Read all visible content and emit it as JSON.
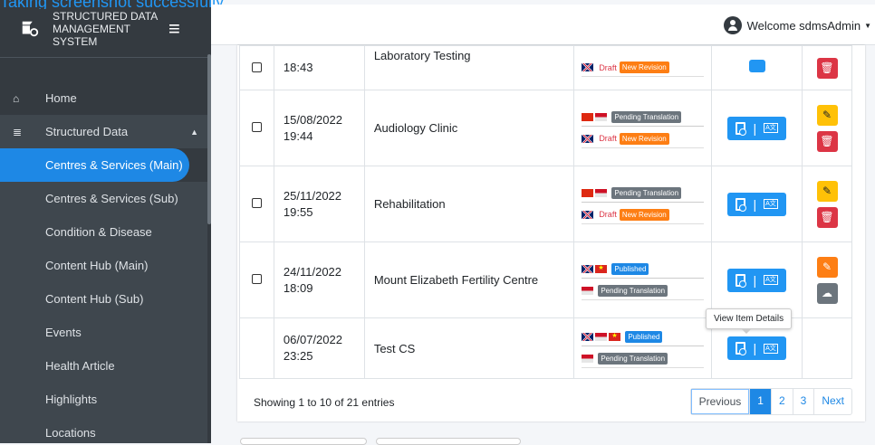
{
  "overlay": {
    "text": "Taking screenshot successfully"
  },
  "brand": {
    "line1": "STRUCTURED DATA",
    "line2": "MANAGEMENT SYSTEM"
  },
  "sidebar": {
    "items": [
      {
        "label": "Home",
        "icon": "home-icon"
      },
      {
        "label": "Structured Data",
        "icon": "database-icon"
      }
    ],
    "sub": [
      {
        "label": "Centres & Services (Main)",
        "active": true
      },
      {
        "label": "Centres & Services (Sub)"
      },
      {
        "label": "Condition & Disease"
      },
      {
        "label": "Content Hub (Main)"
      },
      {
        "label": "Content Hub (Sub)"
      },
      {
        "label": "Events"
      },
      {
        "label": "Health Article"
      },
      {
        "label": "Highlights"
      },
      {
        "label": "Locations"
      }
    ]
  },
  "header": {
    "welcome": "Welcome sdmsAdmin"
  },
  "rows": [
    {
      "date": "",
      "time": "18:43",
      "name": "Laboratory Testing"
    },
    {
      "date": "15/08/2022",
      "time": "19:44",
      "name": "Audiology Clinic"
    },
    {
      "date": "25/11/2022",
      "time": "19:55",
      "name": "Rehabilitation"
    },
    {
      "date": "24/11/2022",
      "time": "18:09",
      "name": "Mount Elizabeth Fertility Centre"
    },
    {
      "date": "06/07/2022",
      "time": "23:25",
      "name": "Test CS"
    }
  ],
  "badges": {
    "pending": "Pending Translation",
    "draft": "Draft",
    "new_revision": "New Revision",
    "published": "Published"
  },
  "tooltip": "View Item Details",
  "footer": {
    "info": "Showing 1 to 10 of 21 entries"
  },
  "pager": {
    "prev": "Previous",
    "p1": "1",
    "p2": "2",
    "p3": "3",
    "next": "Next"
  },
  "colors": {
    "primary": "#1e88e5",
    "sidebar": "#343a40",
    "danger": "#dc3545",
    "warning": "#ffc107"
  }
}
